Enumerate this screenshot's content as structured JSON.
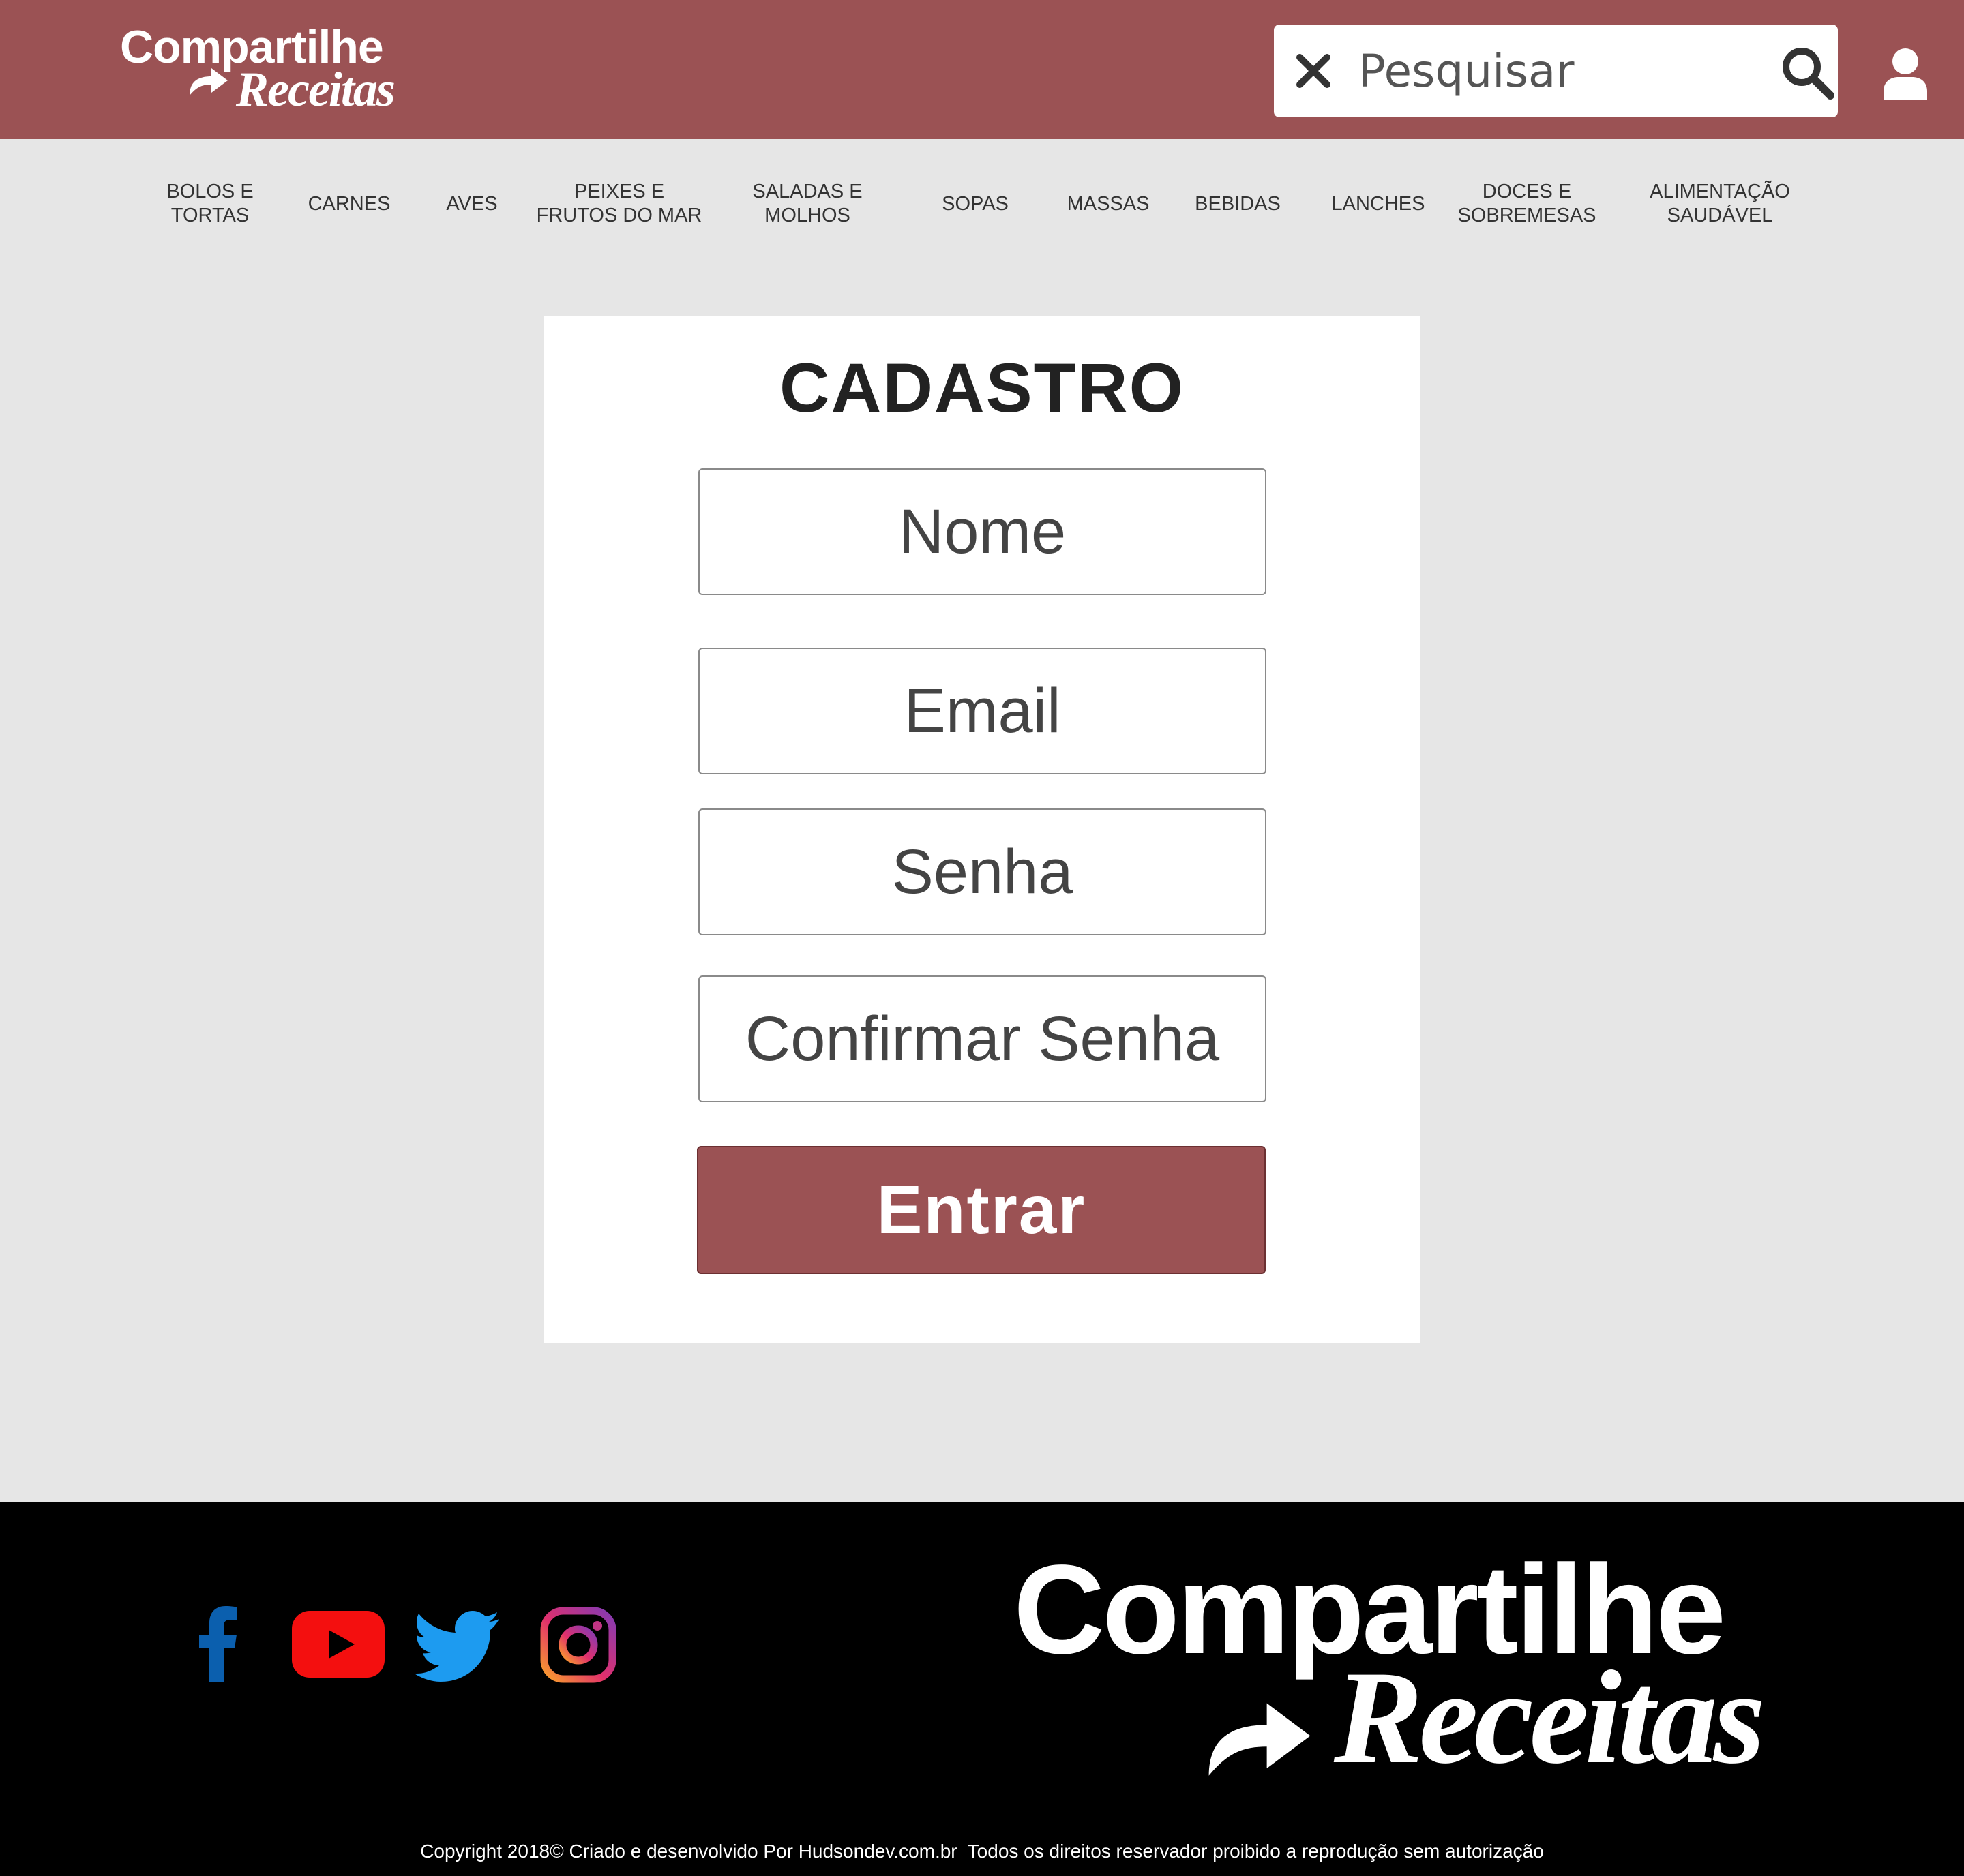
{
  "header": {
    "brand_line1": "Compartilhe",
    "brand_line2": "Receitas",
    "search_placeholder": "Pesquisar",
    "accent_color": "#9b5254"
  },
  "nav": [
    {
      "label": "BOLOS E\nTORTAS"
    },
    {
      "label": "CARNES"
    },
    {
      "label": "AVES"
    },
    {
      "label": "PEIXES E\nFRUTOS DO MAR"
    },
    {
      "label": "SALADAS  E\nMOLHOS"
    },
    {
      "label": "SOPAS"
    },
    {
      "label": "MASSAS"
    },
    {
      "label": "BEBIDAS"
    },
    {
      "label": "LANCHES"
    },
    {
      "label": "DOCES E\nSOBREMESAS"
    },
    {
      "label": "ALIMENTAÇÃO\nSAUDÁVEL"
    }
  ],
  "form": {
    "title": "CADASTRO",
    "name_placeholder": "Nome",
    "email_placeholder": "Email",
    "password_placeholder": "Senha",
    "confirm_placeholder": "Confirmar Senha",
    "submit_label": "Entrar"
  },
  "footer": {
    "brand_line1": "Compartilhe",
    "brand_line2": "Receitas",
    "copyright": "Copyright 2018© Criado e desenvolvido Por Hudsondev.com.br  Todos os direitos reservador proibido a reprodução sem autorização",
    "social_icons": [
      "facebook-icon",
      "youtube-icon",
      "twitter-icon",
      "instagram-icon"
    ]
  }
}
